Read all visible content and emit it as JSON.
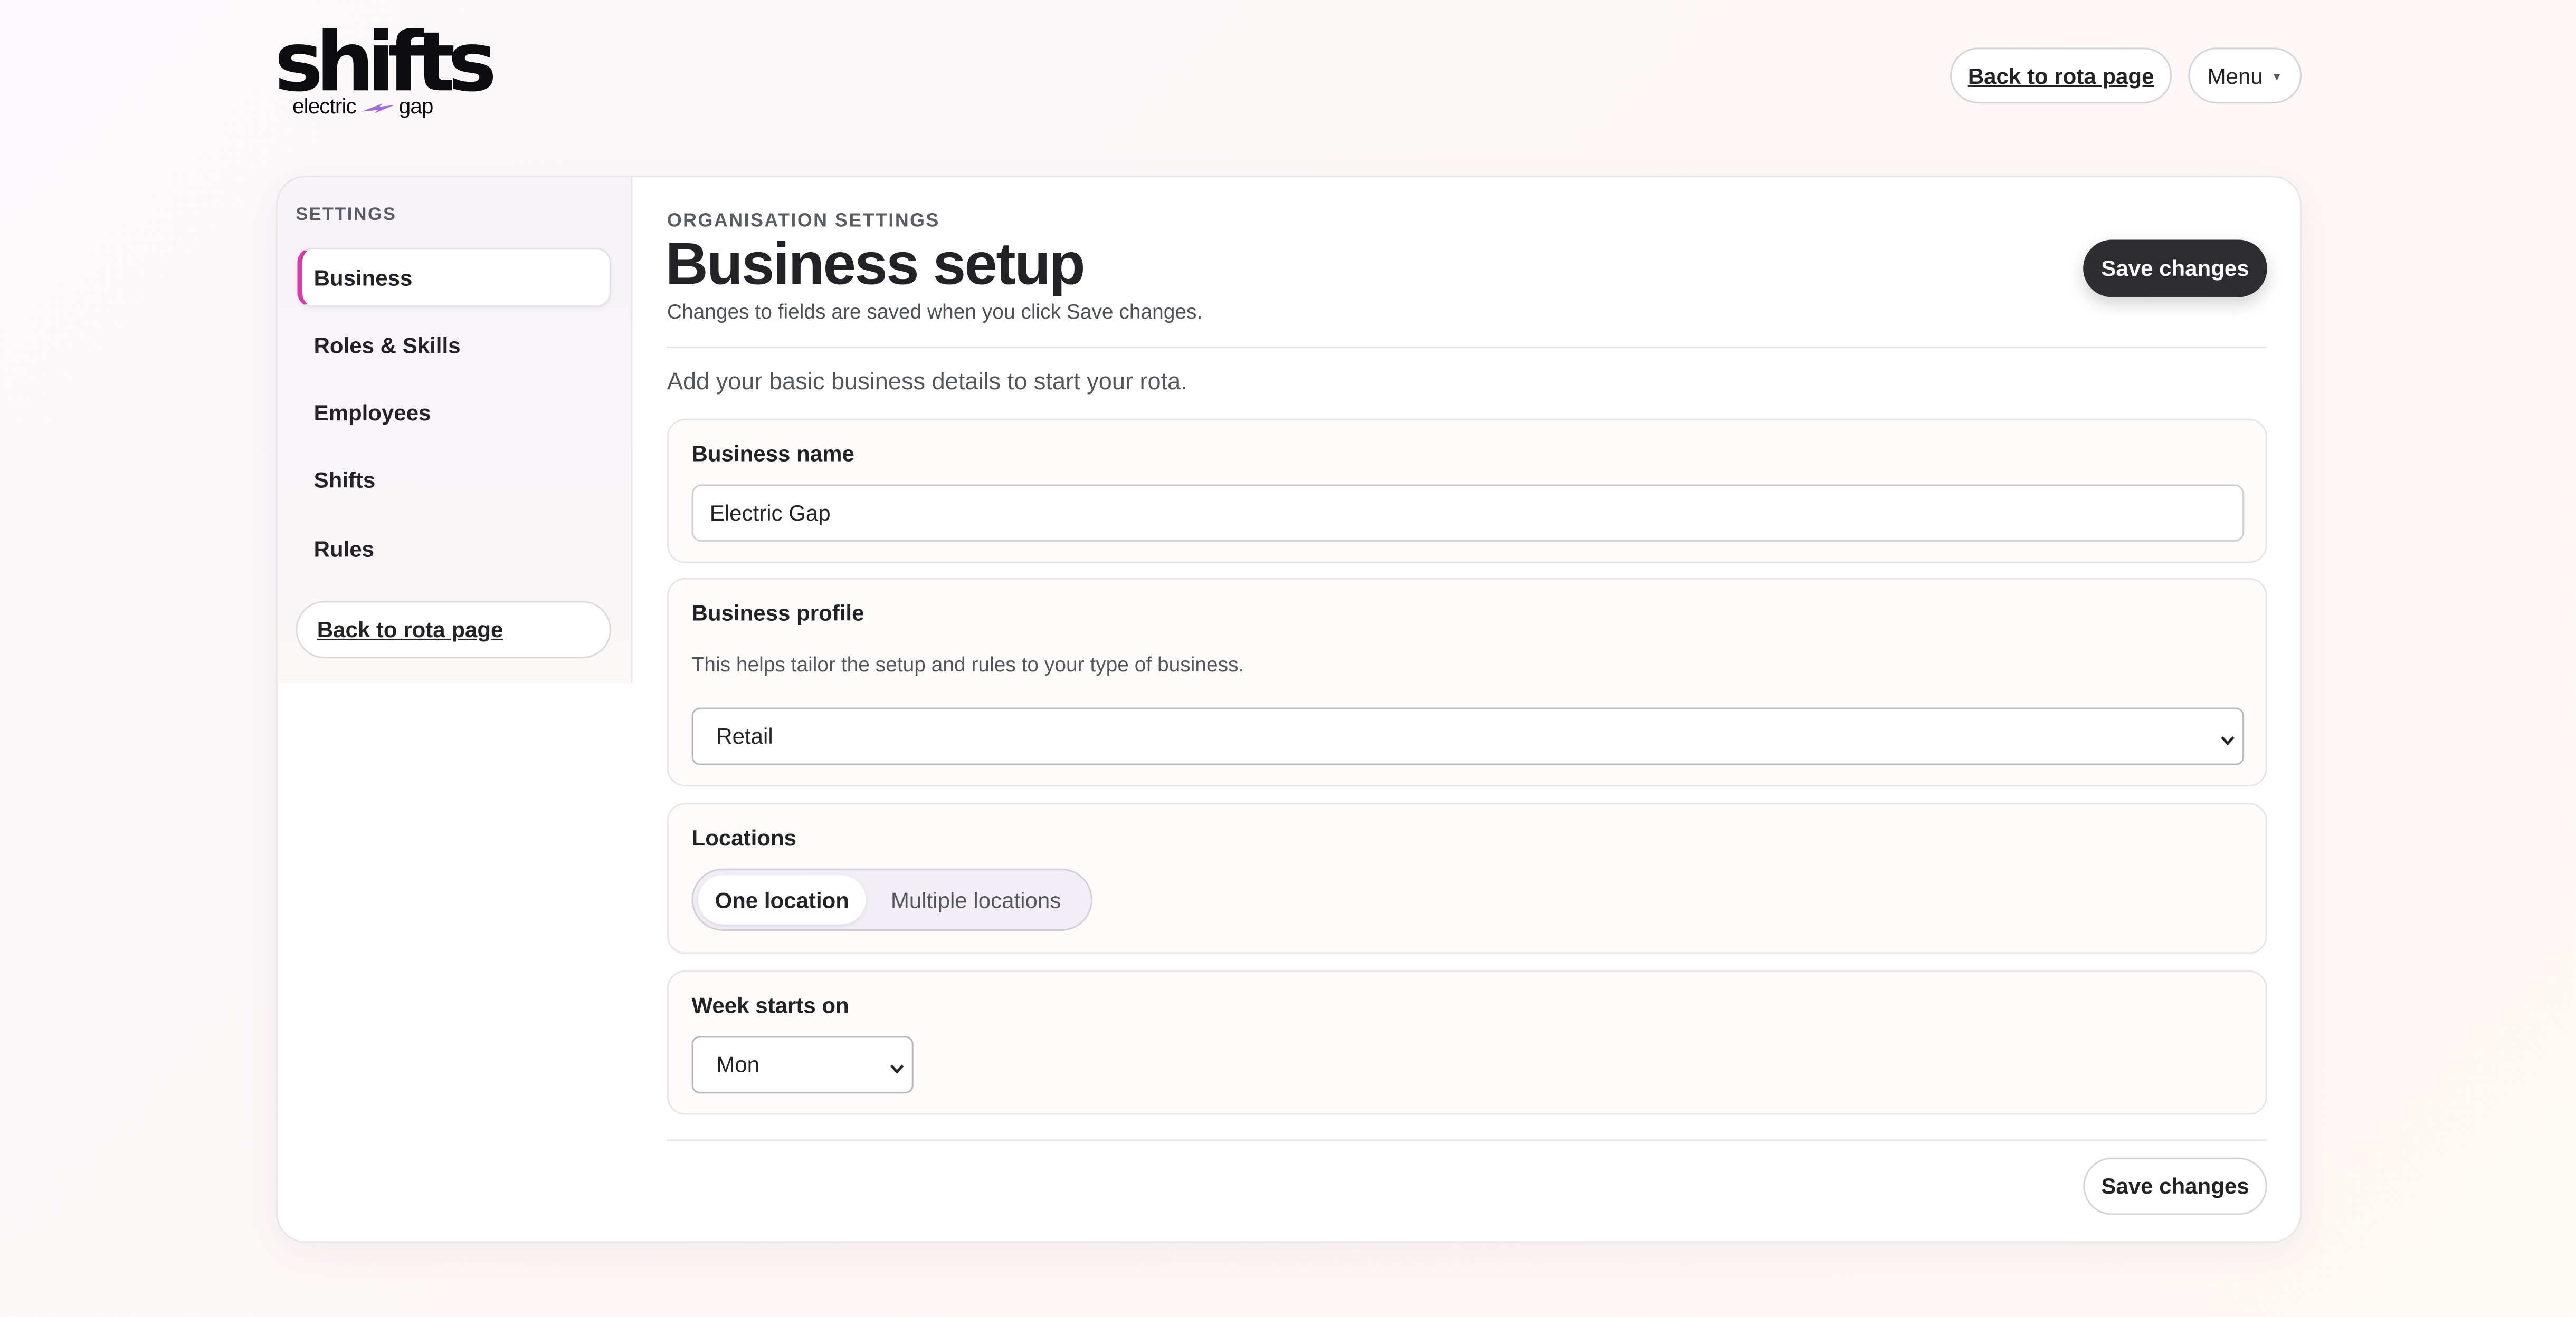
{
  "header": {
    "logo_main": "shifts",
    "logo_left": "electric",
    "logo_right": "gap",
    "back_label": "Back to rota page",
    "menu_label": "Menu"
  },
  "sidebar": {
    "heading": "SETTINGS",
    "items": [
      {
        "label": "Business",
        "active": true
      },
      {
        "label": "Roles & Skills"
      },
      {
        "label": "Employees"
      },
      {
        "label": "Shifts"
      },
      {
        "label": "Rules"
      }
    ],
    "back_label": "Back to rota page"
  },
  "main": {
    "eyebrow": "ORGANISATION SETTINGS",
    "title": "Business setup",
    "subtitle": "Changes to fields are saved when you click Save changes.",
    "save_label": "Save changes",
    "intro": "Add your basic business details to start your rota.",
    "business_name": {
      "label": "Business name",
      "value": "Electric Gap"
    },
    "business_profile": {
      "label": "Business profile",
      "help": "This helps tailor the setup and rules to your type of business.",
      "value": "Retail"
    },
    "locations": {
      "label": "Locations",
      "options": [
        "One location",
        "Multiple locations"
      ],
      "selected": "One location"
    },
    "week_starts": {
      "label": "Week starts on",
      "value": "Mon"
    },
    "save_bottom_label": "Save changes"
  },
  "colors": {
    "accent": "#d43da8",
    "primary_button": "#2c2c31",
    "logo_bolt": "#a16bd9"
  }
}
